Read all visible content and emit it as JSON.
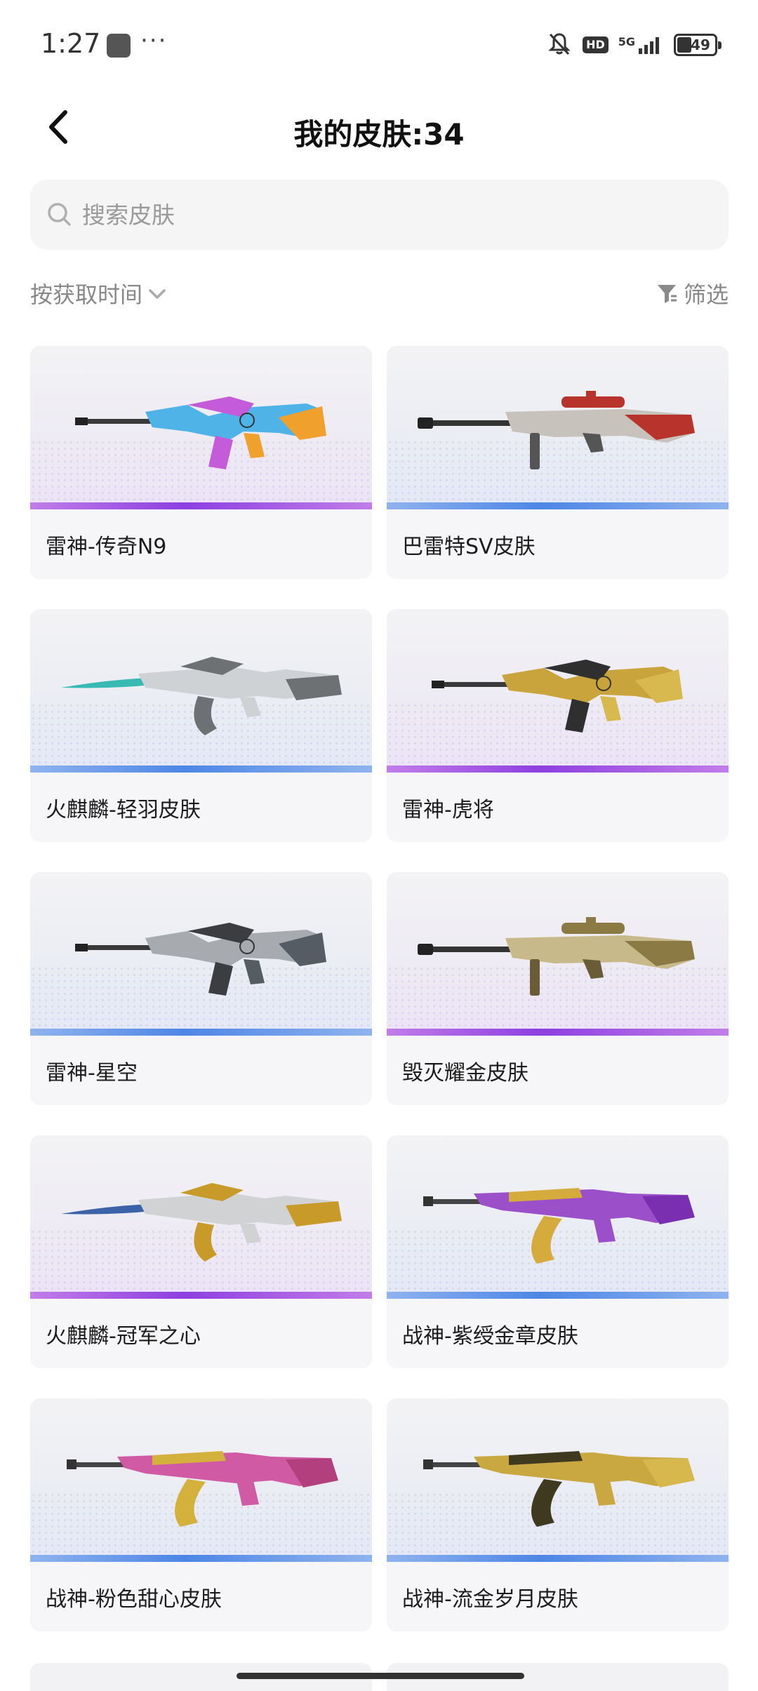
{
  "status_bar": {
    "time": "1:27",
    "dots": "···",
    "hd": "HD",
    "network": "5G",
    "battery": "49"
  },
  "header": {
    "title": "我的皮肤:34"
  },
  "search": {
    "placeholder": "搜索皮肤",
    "value": ""
  },
  "sort": {
    "label": "按获取时间"
  },
  "filter": {
    "label": "筛选"
  },
  "colors": {
    "purple_rarity": "#8d3fe0",
    "blue_rarity": "#4d86e6",
    "card_bg": "#f5f5f7"
  },
  "skins": [
    {
      "name": "雷神-传奇N9",
      "rarity": "purple",
      "weapon_type": "rifle-m4"
    },
    {
      "name": "巴雷特SV皮肤",
      "rarity": "blue",
      "weapon_type": "sniper"
    },
    {
      "name": "火麒麟-轻羽皮肤",
      "rarity": "blue",
      "weapon_type": "ak-blade"
    },
    {
      "name": "雷神-虎将",
      "rarity": "purple",
      "weapon_type": "rifle-m4"
    },
    {
      "name": "雷神-星空",
      "rarity": "blue",
      "weapon_type": "rifle-m4"
    },
    {
      "name": "毁灭耀金皮肤",
      "rarity": "purple",
      "weapon_type": "sniper"
    },
    {
      "name": "火麒麟-冠军之心",
      "rarity": "purple",
      "weapon_type": "ak-blade"
    },
    {
      "name": "战神-紫绶金章皮肤",
      "rarity": "blue",
      "weapon_type": "ak"
    },
    {
      "name": "战神-粉色甜心皮肤",
      "rarity": "blue",
      "weapon_type": "ak"
    },
    {
      "name": "战神-流金岁月皮肤",
      "rarity": "blue",
      "weapon_type": "ak"
    }
  ]
}
